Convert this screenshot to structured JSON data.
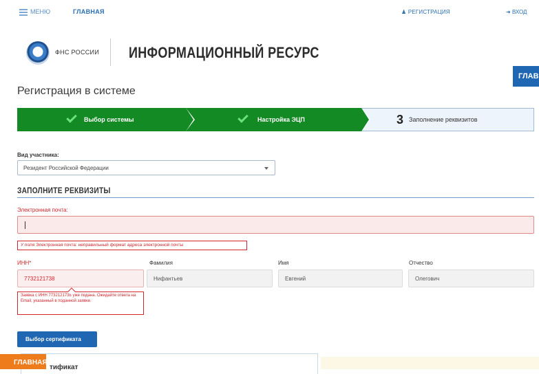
{
  "topbar": {
    "menu_label": "МЕНЮ",
    "home_label": "ГЛАВНАЯ",
    "register_label": "РЕГИСТРАЦИЯ",
    "login_label": "ВХОД"
  },
  "header": {
    "logo_text": "ФНС РОССИИ",
    "title": "ИНФОРМАЦИОННЫЙ РЕСУРС",
    "side_tab_label": "ГЛАВ"
  },
  "page": {
    "title": "Регистрация в системе"
  },
  "steps": [
    {
      "label": "Выбор системы",
      "state": "done"
    },
    {
      "label": "Настройка ЭЦП",
      "state": "done"
    },
    {
      "number": "3",
      "label": "Заполнение реквизитов",
      "state": "current"
    }
  ],
  "participant": {
    "label": "Вид участника:",
    "value": "Резидент Российской Федерации"
  },
  "section": {
    "title": "ЗАПОЛНИТЕ РЕКВИЗИТЫ"
  },
  "email": {
    "label": "Электронная почта:",
    "value": "",
    "error": "У поля Электронная почта: неправильный формат адреса электронной почты"
  },
  "columns": {
    "inn_label": "ИНН*",
    "surname_label": "Фамилия",
    "name_label": "Имя",
    "patronymic_label": "Отчество"
  },
  "values": {
    "inn": "7732121738",
    "surname": "Нифантьев",
    "name": "Евгений",
    "patronymic": "Олегович"
  },
  "inn_error": "Заявка с ИНН 7732121738 уже подана. Ожидайте ответа на Email, указанный в поданной заявке.",
  "buttons": {
    "cert": "Выбор сертификата"
  },
  "cert_panel_title": "тификат",
  "floating_home": "ГЛАВНАЯ",
  "colors": {
    "step_done": "#138a24",
    "primary": "#1f66b3",
    "error": "#d2252b",
    "orange": "#ee7c1a"
  }
}
